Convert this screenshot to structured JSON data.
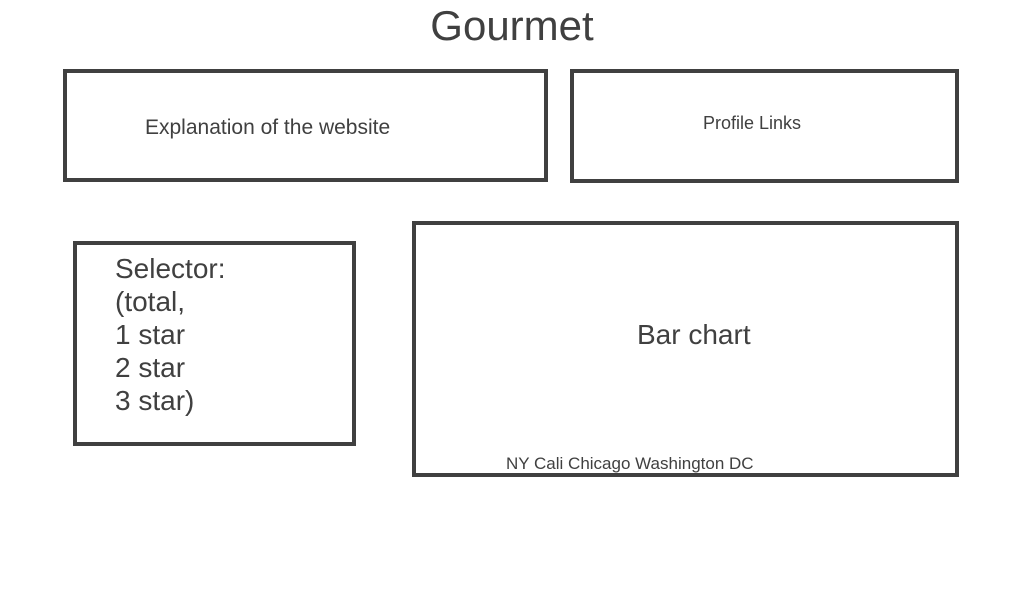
{
  "header": {
    "title": "Gourmet"
  },
  "explanation": {
    "text": "Explanation of the website"
  },
  "profile": {
    "text": "Profile Links"
  },
  "selector": {
    "lines": [
      "Selector:",
      "(total,",
      "1 star",
      "2 star",
      "3 star)"
    ]
  },
  "chart_placeholder": {
    "label": "Bar chart",
    "categories_text": "NY Cali Chicago Washington DC"
  },
  "colors": {
    "stroke": "#404040",
    "text": "#404040",
    "background": "#ffffff"
  }
}
